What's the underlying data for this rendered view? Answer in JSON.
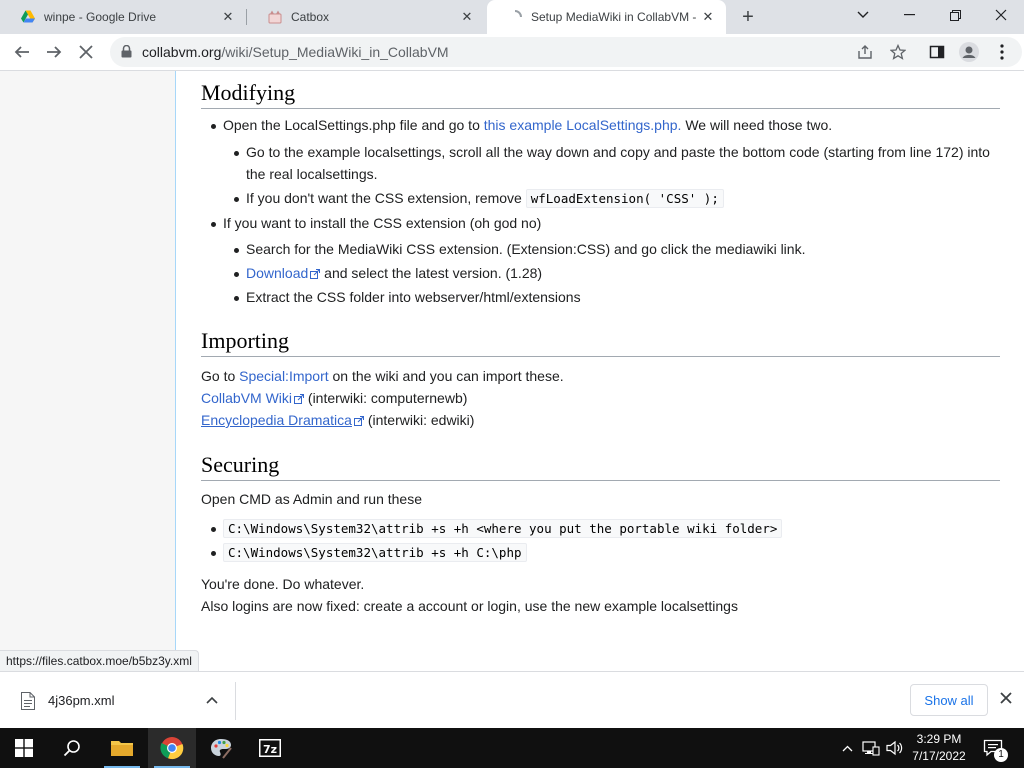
{
  "browser": {
    "tabs": [
      {
        "title": "winpe - Google Drive",
        "icon": "google-drive-icon"
      },
      {
        "title": "Catbox",
        "icon": "catbox-icon"
      },
      {
        "title": "Setup MediaWiki in CollabVM - C",
        "icon": "loading-spinner-icon"
      }
    ],
    "url_host": "collabvm.org",
    "url_path": "/wiki/Setup_MediaWiki_in_CollabVM",
    "status_url": "https://files.catbox.moe/b5bz3y.xml"
  },
  "article": {
    "modifying": {
      "heading": "Modifying",
      "b1_pre": "Open the LocalSettings.php file and go to ",
      "b1_link": "this example LocalSettings.php.",
      "b1_post": " We will need those two.",
      "b1a_line1": "Go to the example localsettings, scroll all the way down and copy and paste the bottom code (starting from line 172) into",
      "b1a_line2": "the real localsettings.",
      "b1b_pre": "If you don't want the CSS extension, remove ",
      "b1b_code": "wfLoadExtension( 'CSS' );",
      "b2": "If you want to install the CSS extension (oh god no)",
      "b2a": "Search for the MediaWiki CSS extension. (Extension:CSS) and go click the mediawiki link.",
      "b2b_link": "Download",
      "b2b_post": " and select the latest version. (1.28)",
      "b2c": "Extract the CSS folder into webserver/html/extensions"
    },
    "importing": {
      "heading": "Importing",
      "l1_pre": "Go to ",
      "l1_link": "Special:Import",
      "l1_post": " on the wiki and you can import these.",
      "l2_link": "CollabVM Wiki",
      "l2_post": " (interwiki: computernewb)",
      "l3_link": "Encyclopedia Dramatica",
      "l3_post": " (interwiki: edwiki)"
    },
    "securing": {
      "heading": "Securing",
      "intro": "Open CMD as Admin and run these",
      "cmd1": "C:\\Windows\\System32\\attrib +s +h <where you put the portable wiki folder>",
      "cmd2": "C:\\Windows\\System32\\attrib +s +h C:\\php",
      "done": "You're done. Do whatever.",
      "logins": "Also logins are now fixed: create a account or login, use the new example localsettings"
    }
  },
  "downloads": {
    "file": "4j36pm.xml",
    "show_all": "Show all"
  },
  "taskbar": {
    "time": "3:29 PM",
    "date": "7/17/2022",
    "notification_count": "1"
  },
  "colors": {
    "link": "#3366cc",
    "tabstrip": "#dee1e6",
    "taskbar": "#101010",
    "accent": "#1a73e8"
  }
}
